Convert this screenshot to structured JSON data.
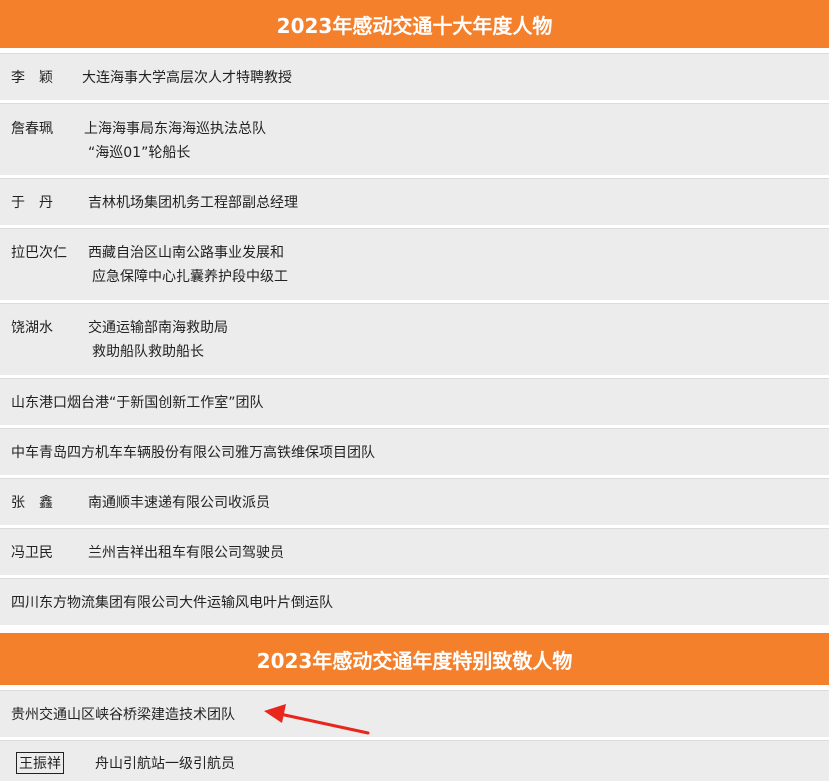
{
  "section1": {
    "title": "2023年感动交通十大年度人物",
    "rows": [
      {
        "name": "李　颖",
        "desc1": "大连海事大学高层次人才特聘教授"
      },
      {
        "name": "詹春珮",
        "desc1": "上海海事局东海海巡执法总队",
        "desc2": "“海巡01”轮船长"
      },
      {
        "name": "于　丹",
        "desc1": "吉林机场集团机务工程部副总经理"
      },
      {
        "name": "拉巴次仁",
        "desc1": "西藏自治区山南公路事业发展和",
        "desc2": "应急保障中心扎囊养护段中级工"
      },
      {
        "name": "饶湖水",
        "desc1": "交通运输部南海救助局",
        "desc2": "救助船队救助船长"
      },
      {
        "text": "山东港口烟台港“于新国创新工作室”团队"
      },
      {
        "text": "中车青岛四方机车车辆股份有限公司雅万高铁维保项目团队"
      },
      {
        "name": "张　鑫",
        "desc1": "南通顺丰速递有限公司收派员"
      },
      {
        "name": "冯卫民",
        "desc1": "兰州吉祥出租车有限公司驾驶员"
      },
      {
        "text": "四川东方物流集团有限公司大件运输风电叶片倒运队"
      }
    ]
  },
  "section2": {
    "title": "2023年感动交通年度特别致敬人物",
    "rows": [
      {
        "text": "贵州交通山区峡谷桥梁建造技术团队"
      },
      {
        "name": "王振祥",
        "desc1": "舟山引航站一级引航员"
      }
    ]
  },
  "colors": {
    "banner": "#f4802c",
    "row_bg": "#ececec",
    "arrow": "#e8261c"
  }
}
